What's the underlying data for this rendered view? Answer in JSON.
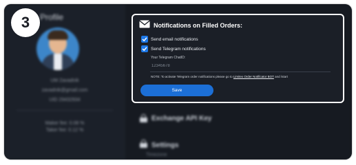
{
  "step": {
    "number": "3"
  },
  "sidebar": {
    "title": "Profile",
    "lines": [
      "UM Zavadnik",
      "zavadnik@gmail.com",
      "UID 29432934"
    ],
    "fees": [
      "Maker fee: 0.08 %",
      "Taker fee: 0.12 %"
    ]
  },
  "sections": {
    "exchange_api_key": "Exchange API Key",
    "settings": "Settings",
    "settings_sub": "Timezone"
  },
  "notifications": {
    "title": "Notifications on Filled Orders:",
    "email_label": "Send email notifications",
    "email_checked": true,
    "telegram_label": "Send Telegram notifications",
    "telegram_checked": true,
    "chat_id_label": "Your Telegram ChatID:",
    "chat_id_value": "12345678",
    "note_prefix": "NOTE: To activate Telegram order notifications please go to ",
    "note_link": "Limitex Order Notificator BOT",
    "note_suffix": " and /start",
    "save_label": "Save"
  },
  "colors": {
    "accent": "#1c6fd6",
    "checkbox": "#1e78e6",
    "background": "#1a1d24"
  }
}
